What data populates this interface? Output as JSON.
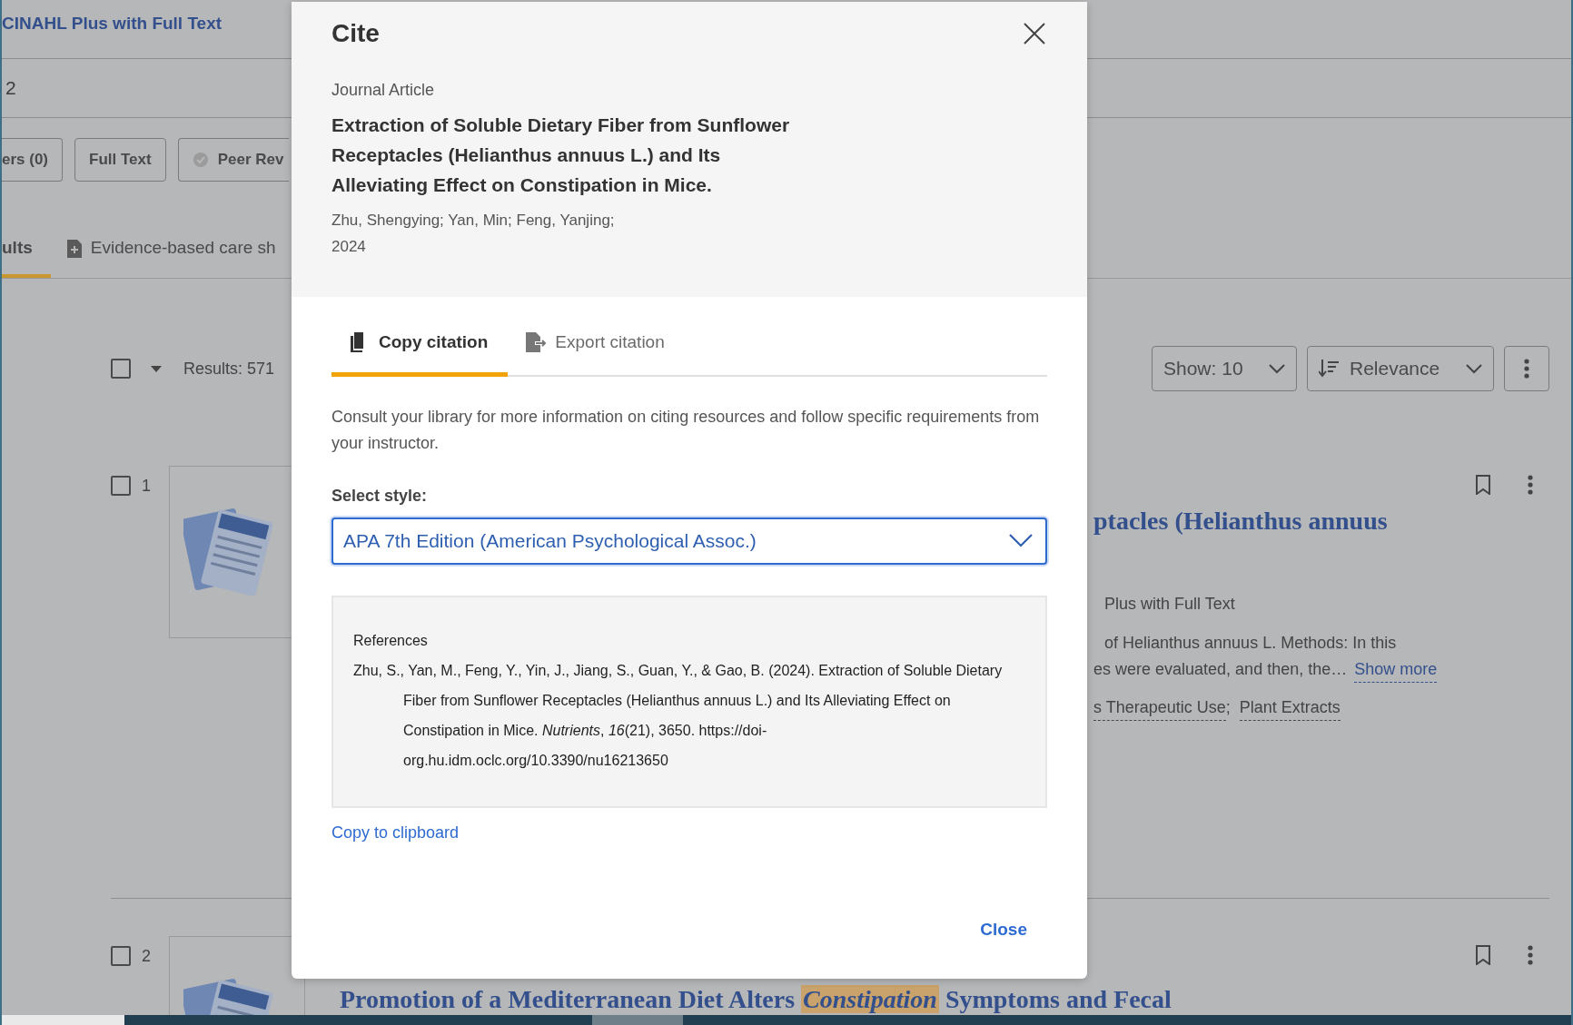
{
  "background_page": {
    "database_name": "CINAHL Plus with Full Text",
    "search_query": "2",
    "filters": [
      {
        "label": "ers (0)",
        "kind": "plain"
      },
      {
        "label": "Full Text",
        "kind": "plain"
      },
      {
        "label": "Peer Rev",
        "kind": "badge"
      }
    ],
    "tabs": [
      {
        "label": "ults",
        "selected": true
      },
      {
        "label": "Evidence-based care sh",
        "selected": false
      }
    ],
    "select_all_checked": false,
    "results_count": "Results: 571",
    "show": "Show: 10",
    "sort": "Relevance",
    "results": [
      {
        "checked": false,
        "number": "1",
        "title": "ptacles (Helianthus annuus",
        "source": "Plus with Full Text",
        "abstract_lines": [
          "of Helianthus annuus L. Methods: In this",
          "es were evaluated, and then, the…"
        ],
        "show_more": "Show more",
        "subjects": [
          "s Therapeutic Use",
          "Plant Extracts"
        ],
        "separator": ";"
      },
      {
        "checked": false,
        "number": "2",
        "title": "Promotion of a Mediterranean Diet Alters *Constipation* Symptoms and Fecal"
      }
    ]
  },
  "dialog": {
    "title": "Cite",
    "type": "Journal Article",
    "article_title": "Extraction of Soluble Dietary Fiber from Sunflower Receptacles (Helianthus annuus L.) and Its Alleviating Effect on Constipation in Mice.",
    "authors": "Zhu, Shengying; Yan, Min; Feng, Yanjing;",
    "year": "2024",
    "tabs": [
      {
        "label": "Copy citation",
        "kind": "copy",
        "selected": true
      },
      {
        "label": "Export citation",
        "kind": "export",
        "selected": false
      }
    ],
    "note": "Consult your library for more information on citing resources and follow specific requirements from your instructor.",
    "select_label": "Select style:",
    "style": "APA 7th Edition (American Psychological Assoc.)",
    "reference_heading": "References",
    "citation": "Zhu, S., Yan, M., Feng, Y., Yin, J., Jiang, S., Guan, Y., & Gao, B. (2024). Extraction of Soluble Dietary Fiber from Sunflower Receptacles (Helianthus annuus L.) and Its Alleviating Effect on Constipation in Mice. *Nutrients*, *16*(21), 3650. https://doi-org.hu.idm.oclc.org/10.3390/nu16213650",
    "copy_link": "Copy to clipboard",
    "close_button": "Close"
  }
}
